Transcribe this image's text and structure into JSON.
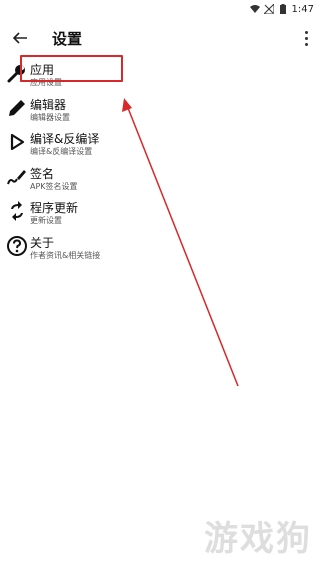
{
  "status_bar": {
    "time": "1:47",
    "icons": [
      "wifi-icon",
      "signal-off-icon",
      "battery-icon"
    ]
  },
  "app_bar": {
    "title": "设置",
    "back_icon": "arrow-left-icon",
    "more_icon": "more-vert-icon"
  },
  "settings": [
    {
      "icon": "wrench-icon",
      "title": "应用",
      "subtitle": "应用设置"
    },
    {
      "icon": "pencil-icon",
      "title": "编辑器",
      "subtitle": "编辑器设置"
    },
    {
      "icon": "play-outline-icon",
      "title": "编译&反编译",
      "subtitle": "编译&反编译设置"
    },
    {
      "icon": "signature-icon",
      "title": "签名",
      "subtitle": "APK签名设置"
    },
    {
      "icon": "sync-icon",
      "title": "程序更新",
      "subtitle": "更新设置"
    },
    {
      "icon": "help-circle-icon",
      "title": "关于",
      "subtitle": "作者资讯&相关链接"
    }
  ],
  "annotation": {
    "color": "#d8282a"
  },
  "watermark": "游戏狗"
}
